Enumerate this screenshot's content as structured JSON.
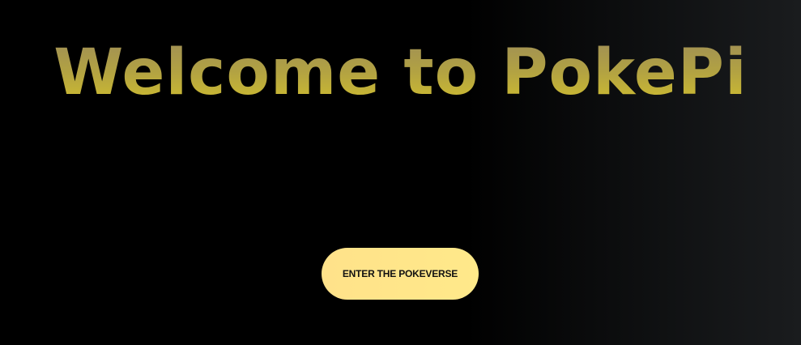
{
  "hero": {
    "title": "Welcome to PokePi"
  },
  "cta": {
    "label": "ENTER THE POKEVERSE"
  },
  "colors": {
    "background_start": "#000000",
    "background_end": "#1a1c1e",
    "title_gradient_top": "#9c8b5a",
    "title_gradient_bottom": "#d6c42a",
    "button_fill": "#ffe58a",
    "button_text": "#111111"
  }
}
